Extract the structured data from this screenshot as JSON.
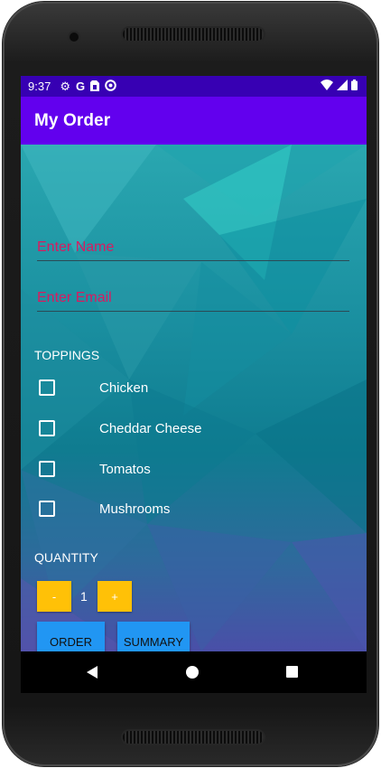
{
  "status_bar": {
    "time": "9:37",
    "icons": [
      "gear-icon",
      "google-icon",
      "sim-card-icon",
      "do-not-disturb-icon"
    ],
    "right_icons": [
      "wifi-icon",
      "signal-icon",
      "battery-icon"
    ]
  },
  "app_bar": {
    "title": "My Order"
  },
  "form": {
    "name_placeholder": "Enter Name",
    "email_placeholder": "Enter Email"
  },
  "toppings": {
    "label": "TOPPINGS",
    "items": [
      {
        "label": "Chicken",
        "checked": false
      },
      {
        "label": "Cheddar Cheese",
        "checked": false
      },
      {
        "label": "Tomatos",
        "checked": false
      },
      {
        "label": "Mushrooms",
        "checked": false
      }
    ]
  },
  "quantity": {
    "label": "QUANTITY",
    "decrement_label": "-",
    "increment_label": "+",
    "value": "1"
  },
  "actions": {
    "order_label": "ORDER",
    "summary_label": "SUMMARY"
  },
  "colors": {
    "status_bar": "#3700b3",
    "app_bar": "#6200ee",
    "hint_text": "#d81b60",
    "quantity_button": "#ffc107",
    "action_button": "#2196f3"
  }
}
